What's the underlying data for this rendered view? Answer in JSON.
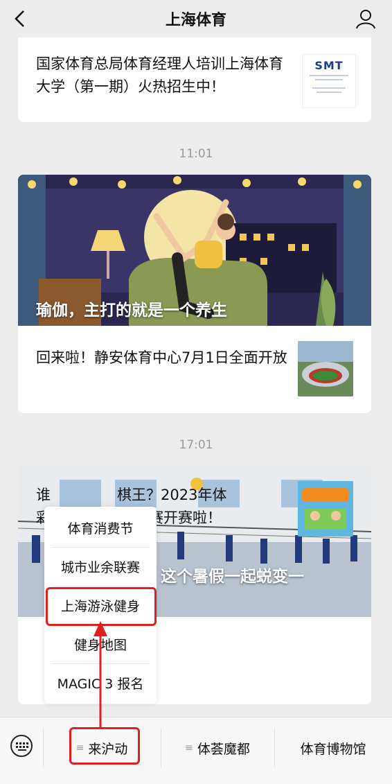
{
  "header": {
    "title": "上海体育"
  },
  "feed": {
    "card1": {
      "title": "国家体育总局体育经理人培训上海体育大学（第一期）火热招生中！",
      "thumb_logo": "SMT"
    },
    "time1": "11:01",
    "card2": {
      "hero_title": "瑜伽，主打的就是一个养生",
      "item_title": "回来啦！静安体育中心7月1日全面开放"
    },
    "time2": "17:01",
    "card3": {
      "hero_title": "拉！这个暑假一起蜕变一",
      "item_title_line1": "谁",
      "item_title_line1_tail": "棋王？2023年体",
      "item_title_line2": "彩",
      "item_title_line2_tail": "赛开赛啦！"
    }
  },
  "popup_menu": {
    "items": [
      "体育消费节",
      "城市业余联赛",
      "上海游泳健身",
      "健身地图",
      "MAGIC 3 报名"
    ],
    "highlighted_index": 2
  },
  "bottom_menu": {
    "tabs": [
      {
        "label": "来沪动",
        "has_submenu": true
      },
      {
        "label": "体荟魔都",
        "has_submenu": true
      },
      {
        "label": "体育博物馆",
        "has_submenu": false
      }
    ]
  },
  "colors": {
    "highlight_red": "#e02020",
    "background": "#ededed"
  },
  "icons": [
    "back-arrow-icon",
    "profile-icon",
    "keyboard-icon",
    "menu-burger-icon",
    "up-arrow-icon"
  ]
}
